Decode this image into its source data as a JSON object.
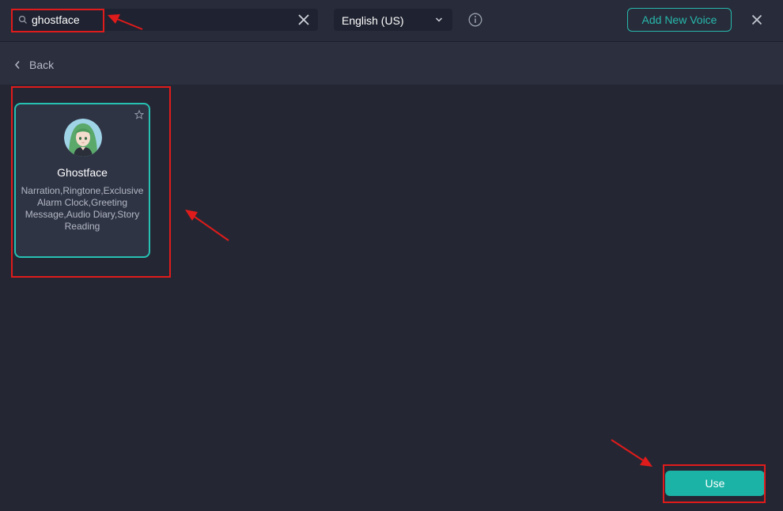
{
  "search": {
    "value": "ghostface",
    "placeholder": ""
  },
  "language": {
    "selected": "English (US)"
  },
  "header": {
    "add_voice_label": "Add New Voice"
  },
  "nav": {
    "back_label": "Back"
  },
  "voice": {
    "name": "Ghostface",
    "tags": "Narration,Ringtone,Exclusive Alarm Clock,Greeting Message,Audio Diary,Story Reading"
  },
  "footer": {
    "use_label": "Use"
  },
  "colors": {
    "accent": "#1bb3a5",
    "card_border": "#26c1b3",
    "annotation": "#e01b1b"
  },
  "icons": [
    "search-icon",
    "clear-icon",
    "chevron-down-icon",
    "info-icon",
    "close-icon",
    "chevron-left-icon",
    "star-icon",
    "avatar-image"
  ]
}
